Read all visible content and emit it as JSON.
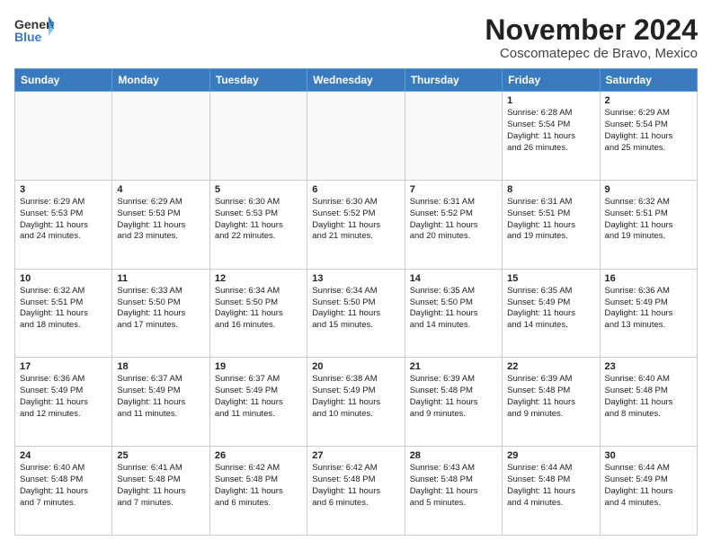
{
  "header": {
    "logo_general": "General",
    "logo_blue": "Blue",
    "month_title": "November 2024",
    "location": "Coscomatepec de Bravo, Mexico"
  },
  "weekdays": [
    "Sunday",
    "Monday",
    "Tuesday",
    "Wednesday",
    "Thursday",
    "Friday",
    "Saturday"
  ],
  "weeks": [
    [
      {
        "day": "",
        "info": ""
      },
      {
        "day": "",
        "info": ""
      },
      {
        "day": "",
        "info": ""
      },
      {
        "day": "",
        "info": ""
      },
      {
        "day": "",
        "info": ""
      },
      {
        "day": "1",
        "info": "Sunrise: 6:28 AM\nSunset: 5:54 PM\nDaylight: 11 hours\nand 26 minutes."
      },
      {
        "day": "2",
        "info": "Sunrise: 6:29 AM\nSunset: 5:54 PM\nDaylight: 11 hours\nand 25 minutes."
      }
    ],
    [
      {
        "day": "3",
        "info": "Sunrise: 6:29 AM\nSunset: 5:53 PM\nDaylight: 11 hours\nand 24 minutes."
      },
      {
        "day": "4",
        "info": "Sunrise: 6:29 AM\nSunset: 5:53 PM\nDaylight: 11 hours\nand 23 minutes."
      },
      {
        "day": "5",
        "info": "Sunrise: 6:30 AM\nSunset: 5:53 PM\nDaylight: 11 hours\nand 22 minutes."
      },
      {
        "day": "6",
        "info": "Sunrise: 6:30 AM\nSunset: 5:52 PM\nDaylight: 11 hours\nand 21 minutes."
      },
      {
        "day": "7",
        "info": "Sunrise: 6:31 AM\nSunset: 5:52 PM\nDaylight: 11 hours\nand 20 minutes."
      },
      {
        "day": "8",
        "info": "Sunrise: 6:31 AM\nSunset: 5:51 PM\nDaylight: 11 hours\nand 19 minutes."
      },
      {
        "day": "9",
        "info": "Sunrise: 6:32 AM\nSunset: 5:51 PM\nDaylight: 11 hours\nand 19 minutes."
      }
    ],
    [
      {
        "day": "10",
        "info": "Sunrise: 6:32 AM\nSunset: 5:51 PM\nDaylight: 11 hours\nand 18 minutes."
      },
      {
        "day": "11",
        "info": "Sunrise: 6:33 AM\nSunset: 5:50 PM\nDaylight: 11 hours\nand 17 minutes."
      },
      {
        "day": "12",
        "info": "Sunrise: 6:34 AM\nSunset: 5:50 PM\nDaylight: 11 hours\nand 16 minutes."
      },
      {
        "day": "13",
        "info": "Sunrise: 6:34 AM\nSunset: 5:50 PM\nDaylight: 11 hours\nand 15 minutes."
      },
      {
        "day": "14",
        "info": "Sunrise: 6:35 AM\nSunset: 5:50 PM\nDaylight: 11 hours\nand 14 minutes."
      },
      {
        "day": "15",
        "info": "Sunrise: 6:35 AM\nSunset: 5:49 PM\nDaylight: 11 hours\nand 14 minutes."
      },
      {
        "day": "16",
        "info": "Sunrise: 6:36 AM\nSunset: 5:49 PM\nDaylight: 11 hours\nand 13 minutes."
      }
    ],
    [
      {
        "day": "17",
        "info": "Sunrise: 6:36 AM\nSunset: 5:49 PM\nDaylight: 11 hours\nand 12 minutes."
      },
      {
        "day": "18",
        "info": "Sunrise: 6:37 AM\nSunset: 5:49 PM\nDaylight: 11 hours\nand 11 minutes."
      },
      {
        "day": "19",
        "info": "Sunrise: 6:37 AM\nSunset: 5:49 PM\nDaylight: 11 hours\nand 11 minutes."
      },
      {
        "day": "20",
        "info": "Sunrise: 6:38 AM\nSunset: 5:49 PM\nDaylight: 11 hours\nand 10 minutes."
      },
      {
        "day": "21",
        "info": "Sunrise: 6:39 AM\nSunset: 5:48 PM\nDaylight: 11 hours\nand 9 minutes."
      },
      {
        "day": "22",
        "info": "Sunrise: 6:39 AM\nSunset: 5:48 PM\nDaylight: 11 hours\nand 9 minutes."
      },
      {
        "day": "23",
        "info": "Sunrise: 6:40 AM\nSunset: 5:48 PM\nDaylight: 11 hours\nand 8 minutes."
      }
    ],
    [
      {
        "day": "24",
        "info": "Sunrise: 6:40 AM\nSunset: 5:48 PM\nDaylight: 11 hours\nand 7 minutes."
      },
      {
        "day": "25",
        "info": "Sunrise: 6:41 AM\nSunset: 5:48 PM\nDaylight: 11 hours\nand 7 minutes."
      },
      {
        "day": "26",
        "info": "Sunrise: 6:42 AM\nSunset: 5:48 PM\nDaylight: 11 hours\nand 6 minutes."
      },
      {
        "day": "27",
        "info": "Sunrise: 6:42 AM\nSunset: 5:48 PM\nDaylight: 11 hours\nand 6 minutes."
      },
      {
        "day": "28",
        "info": "Sunrise: 6:43 AM\nSunset: 5:48 PM\nDaylight: 11 hours\nand 5 minutes."
      },
      {
        "day": "29",
        "info": "Sunrise: 6:44 AM\nSunset: 5:48 PM\nDaylight: 11 hours\nand 4 minutes."
      },
      {
        "day": "30",
        "info": "Sunrise: 6:44 AM\nSunset: 5:49 PM\nDaylight: 11 hours\nand 4 minutes."
      }
    ]
  ]
}
